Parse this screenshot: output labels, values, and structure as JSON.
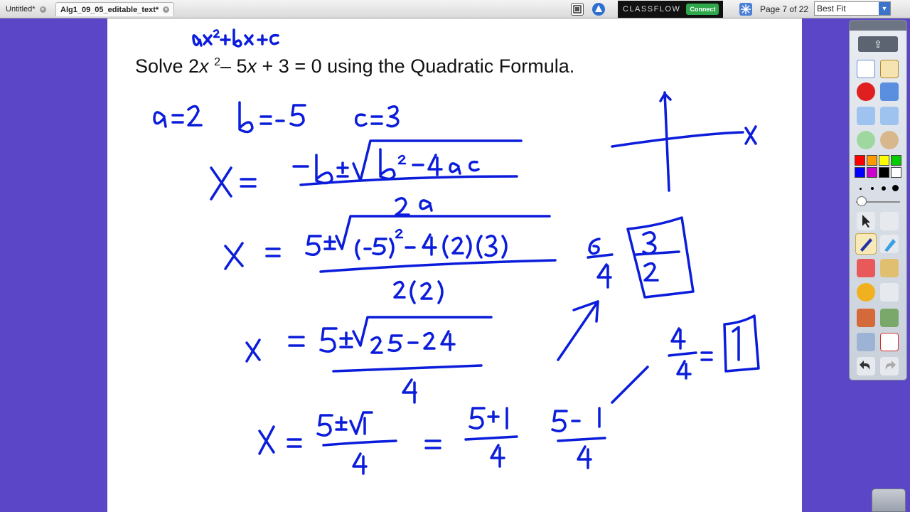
{
  "tabs": [
    {
      "label": "Untitled*",
      "active": false
    },
    {
      "label": "Alg1_09_05_editable_text*",
      "active": true
    }
  ],
  "toolbar": {
    "brand": "CLASSFLOW",
    "connect_label": "Connect",
    "page_indicator": "Page 7 of 22",
    "zoom_value": "Best Fit"
  },
  "flipchart": {
    "question_prefix": "Solve 2",
    "question_x1": "x",
    "question_exp": "2",
    "question_mid": "– 5",
    "question_x2": "x",
    "question_suffix": " + 3 = 0 using the Quadratic Formula."
  },
  "colors": {
    "background": "#5b46c8",
    "ink": "#0b1ddb",
    "palette": [
      "#ff0000",
      "#ff9900",
      "#ffff00",
      "#00cc00",
      "#0000ff",
      "#cc00cc",
      "#000000",
      "#ffffff"
    ]
  }
}
